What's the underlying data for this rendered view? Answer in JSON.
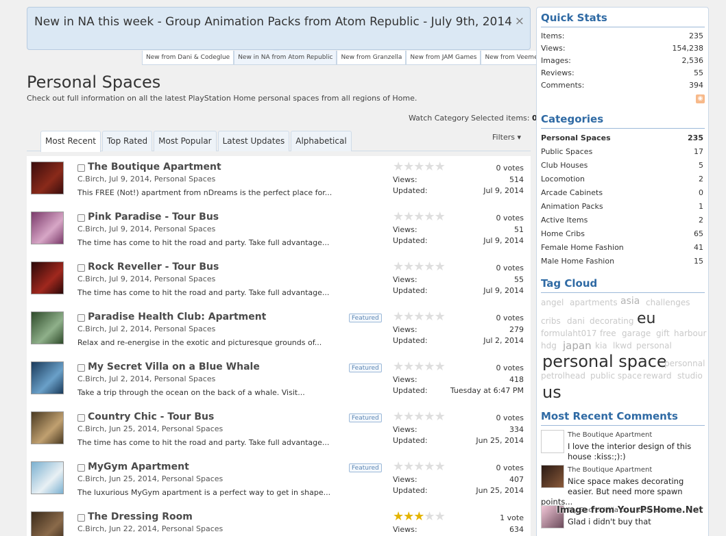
{
  "notice": {
    "text": "New in NA this week - Group Animation Packs from Atom Republic - July 9th, 2014",
    "close": "×",
    "tabs": [
      "New from Dani & Codeglue",
      "New in NA from Atom Republic",
      "New from Granzella",
      "New from JAM Games",
      "New from Veemee"
    ]
  },
  "page": {
    "title": "Personal Spaces",
    "description": "Check out full information on all the latest PlayStation Home personal spaces from all regions of Home.",
    "watch_label": "Watch Category",
    "selected_label": "Selected items:",
    "selected_count": "0"
  },
  "tabs": [
    "Most Recent",
    "Top Rated",
    "Most Popular",
    "Latest Updates",
    "Alphabetical"
  ],
  "filters_label": "Filters ▾",
  "labels": {
    "views": "Views:",
    "updated": "Updated:",
    "featured": "Featured"
  },
  "items": [
    {
      "title": "The Boutique Apartment",
      "meta": "C.Birch, Jul 9, 2014, Personal Spaces",
      "snippet": "This FREE (Not!) apartment from nDreams is the perfect place for...",
      "featured": false,
      "rating": 0,
      "votes": "0 votes",
      "views": "514",
      "updated": "Jul 9, 2014",
      "thumb": [
        "#3a0d0d",
        "#8a2a1a"
      ]
    },
    {
      "title": "Pink Paradise - Tour Bus",
      "meta": "C.Birch, Jul 9, 2014, Personal Spaces",
      "snippet": "The time has come to hit the road and party. Take full advantage...",
      "featured": false,
      "rating": 0,
      "votes": "0 votes",
      "views": "51",
      "updated": "Jul 9, 2014",
      "thumb": [
        "#7a3a6a",
        "#d7a6c6"
      ]
    },
    {
      "title": "Rock Reveller - Tour Bus",
      "meta": "C.Birch, Jul 9, 2014, Personal Spaces",
      "snippet": "The time has come to hit the road and party. Take full advantage...",
      "featured": false,
      "rating": 0,
      "votes": "0 votes",
      "views": "55",
      "updated": "Jul 9, 2014",
      "thumb": [
        "#2a0808",
        "#a0281e"
      ]
    },
    {
      "title": "Paradise Health Club: Apartment",
      "meta": "C.Birch, Jul 2, 2014, Personal Spaces",
      "snippet": "Relax and re-energise in the exotic and picturesque grounds of...",
      "featured": true,
      "rating": 0,
      "votes": "0 votes",
      "views": "279",
      "updated": "Jul 2, 2014",
      "thumb": [
        "#2e4a2a",
        "#8fb08a"
      ]
    },
    {
      "title": "My Secret Villa on a Blue Whale",
      "meta": "C.Birch, Jul 2, 2014, Personal Spaces",
      "snippet": "Take a trip through the ocean on the back of a whale. Visit...",
      "featured": true,
      "rating": 0,
      "votes": "0 votes",
      "views": "418",
      "updated": "Tuesday at 6:47 PM",
      "thumb": [
        "#1a3a5a",
        "#6aa0c8"
      ]
    },
    {
      "title": "Country Chic - Tour Bus",
      "meta": "C.Birch, Jun 25, 2014, Personal Spaces",
      "snippet": "The time has come to hit the road and party. Take full advantage...",
      "featured": true,
      "rating": 0,
      "votes": "0 votes",
      "views": "334",
      "updated": "Jun 25, 2014",
      "thumb": [
        "#4a3a22",
        "#c0a070"
      ]
    },
    {
      "title": "MyGym Apartment",
      "meta": "C.Birch, Jun 25, 2014, Personal Spaces",
      "snippet": "The luxurious MyGym apartment is a perfect way to get in shape...",
      "featured": true,
      "rating": 0,
      "votes": "0 votes",
      "views": "407",
      "updated": "Jun 25, 2014",
      "thumb": [
        "#7ab0d0",
        "#e8f0f4"
      ]
    },
    {
      "title": "The Dressing Room",
      "meta": "C.Birch, Jun 22, 2014, Personal Spaces",
      "snippet": "",
      "featured": false,
      "rating": 3,
      "votes": "1 vote",
      "views": "634",
      "updated": "",
      "thumb": [
        "#3a2a1a",
        "#8a6a4a"
      ]
    }
  ],
  "sidebar": {
    "quick_stats": {
      "heading": "Quick Stats",
      "rows": [
        {
          "label": "Items:",
          "value": "235"
        },
        {
          "label": "Views:",
          "value": "154,238"
        },
        {
          "label": "Images:",
          "value": "2,536"
        },
        {
          "label": "Reviews:",
          "value": "55"
        },
        {
          "label": "Comments:",
          "value": "394"
        }
      ]
    },
    "categories": {
      "heading": "Categories",
      "rows": [
        {
          "label": "Personal Spaces",
          "value": "235",
          "active": true
        },
        {
          "label": "Public Spaces",
          "value": "17",
          "active": false
        },
        {
          "label": "Club Houses",
          "value": "5",
          "active": false
        },
        {
          "label": "Locomotion",
          "value": "2",
          "active": false
        },
        {
          "label": "Arcade Cabinets",
          "value": "0",
          "active": false
        },
        {
          "label": "Animation Packs",
          "value": "1",
          "active": false
        },
        {
          "label": "Active Items",
          "value": "2",
          "active": false
        },
        {
          "label": "Home Cribs",
          "value": "65",
          "active": false
        },
        {
          "label": "Female Home Fashion",
          "value": "41",
          "active": false
        },
        {
          "label": "Male Home Fashion",
          "value": "15",
          "active": false
        }
      ]
    },
    "tag_cloud": {
      "heading": "Tag Cloud",
      "tags": [
        "angel",
        "apartments",
        "asia",
        "challenges",
        "cribs",
        "dani",
        "decorating",
        "eu",
        "formulaht017",
        "free",
        "garage",
        "gift",
        "harbour",
        "hdg",
        "japan",
        "kia",
        "lkwd",
        "personal",
        "personal space",
        "personnal",
        "petrolhead",
        "public space",
        "reward",
        "studio",
        "us"
      ]
    },
    "comments": {
      "heading": "Most Recent Comments",
      "items": [
        {
          "title": "The Boutique Apartment",
          "lines": [
            "I love the interior design of this",
            "house :kiss:;):)"
          ]
        },
        {
          "title": "The Boutique Apartment",
          "lines": [
            "Nice space makes decorating",
            "easier. But need more spawn",
            "points..."
          ]
        },
        {
          "title": "My Secret Villa on a Blue Whale",
          "lines": [
            "Glad i didn't buy that"
          ]
        }
      ]
    }
  },
  "watermark": "Image from YourPSHome.Net"
}
